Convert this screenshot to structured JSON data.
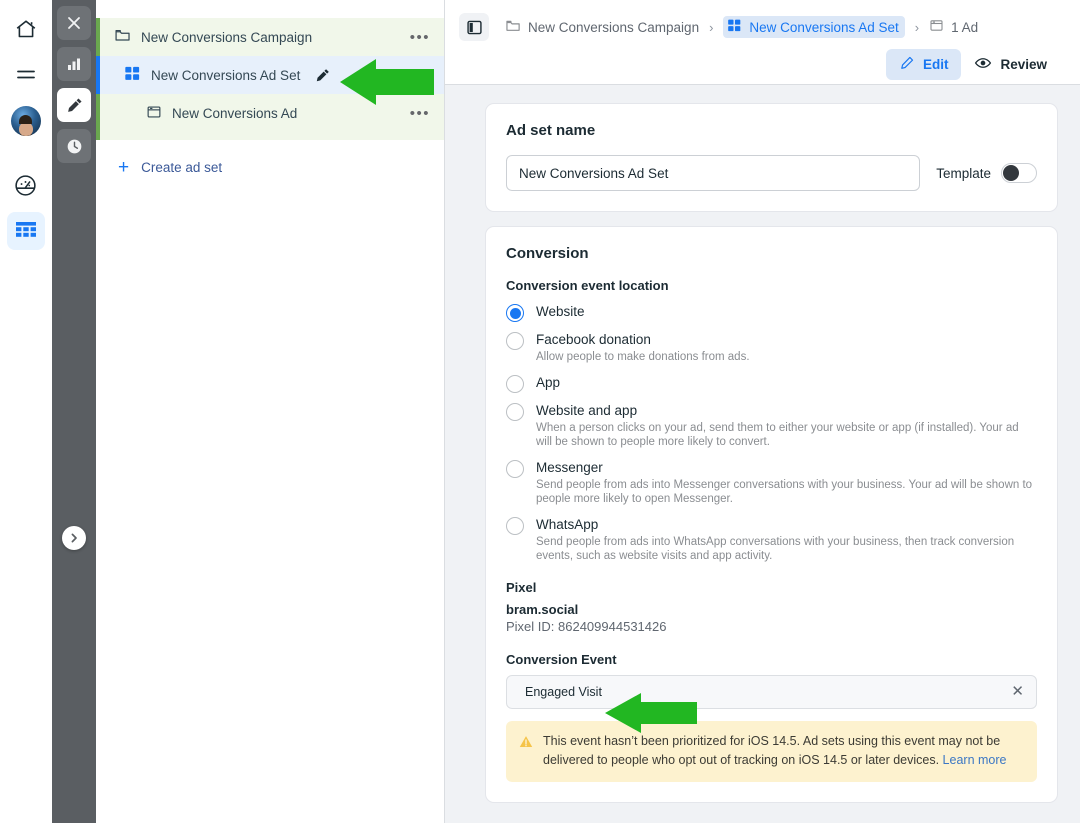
{
  "left_rail": {
    "items": [
      {
        "name": "home-icon",
        "label": "Home"
      },
      {
        "name": "menu-icon",
        "label": "Menu"
      },
      {
        "name": "avatar",
        "label": "Profile"
      },
      {
        "name": "speedometer-icon",
        "label": "Performance"
      },
      {
        "name": "grid-table-icon",
        "label": "Ads manager"
      }
    ]
  },
  "dark_rail": {
    "items": [
      {
        "name": "close-icon",
        "label": "Close"
      },
      {
        "name": "bar-chart-icon",
        "label": "Charts"
      },
      {
        "name": "pencil-icon",
        "label": "Edit"
      },
      {
        "name": "clock-icon",
        "label": "History"
      }
    ],
    "expand_label": "Expand"
  },
  "tree": {
    "campaign": {
      "label": "New Conversions Campaign",
      "menu": "•••"
    },
    "adset": {
      "label": "New Conversions Ad Set"
    },
    "ad": {
      "label": "New Conversions Ad",
      "menu": "•••"
    },
    "create": {
      "plus": "+",
      "label": "Create ad set"
    }
  },
  "breadcrumb": {
    "campaign": "New Conversions Campaign",
    "adset": "New Conversions Ad Set",
    "ads": "1 Ad",
    "separator": "›"
  },
  "actions": {
    "edit": "Edit",
    "review": "Review"
  },
  "adset_name": {
    "heading": "Ad set name",
    "value": "New Conversions Ad Set",
    "placeholder": "Ad set name",
    "template_label": "Template"
  },
  "conversion": {
    "heading": "Conversion",
    "location_label": "Conversion event location",
    "options": [
      {
        "title": "Website",
        "desc": "",
        "selected": true
      },
      {
        "title": "Facebook donation",
        "desc": "Allow people to make donations from ads.",
        "selected": false
      },
      {
        "title": "App",
        "desc": "",
        "selected": false
      },
      {
        "title": "Website and app",
        "desc": "When a person clicks on your ad, send them to either your website or app (if installed). Your ad will be shown to people more likely to convert.",
        "selected": false
      },
      {
        "title": "Messenger",
        "desc": "Send people from ads into Messenger conversations with your business. Your ad will be shown to people more likely to open Messenger.",
        "selected": false
      },
      {
        "title": "WhatsApp",
        "desc": "Send people from ads into WhatsApp conversations with your business, then track conversion events, such as website visits and app activity.",
        "selected": false
      }
    ],
    "pixel_heading": "Pixel",
    "pixel_name": "bram.social",
    "pixel_id": "Pixel ID: 862409944531426",
    "event_heading": "Conversion Event",
    "event_value": "Engaged Visit",
    "event_clear": "✕",
    "warning_text": "This event hasn’t been prioritized for iOS 14.5. Ad sets using this event may not be delivered to people who opt out of tracking on iOS 14.5 or later devices. ",
    "warning_link": "Learn more"
  },
  "annotations": {
    "arrow1": "green-arrow-pointing-to-ad-set-row",
    "arrow2": "green-arrow-pointing-to-conversion-event"
  },
  "colors": {
    "accent_blue": "#1877f2",
    "arrow_green": "#22b722",
    "tree_green_bg": "#f1f7ea",
    "tree_blue_bg": "#e7f0fb",
    "warning_bg": "#fdf2cf"
  }
}
